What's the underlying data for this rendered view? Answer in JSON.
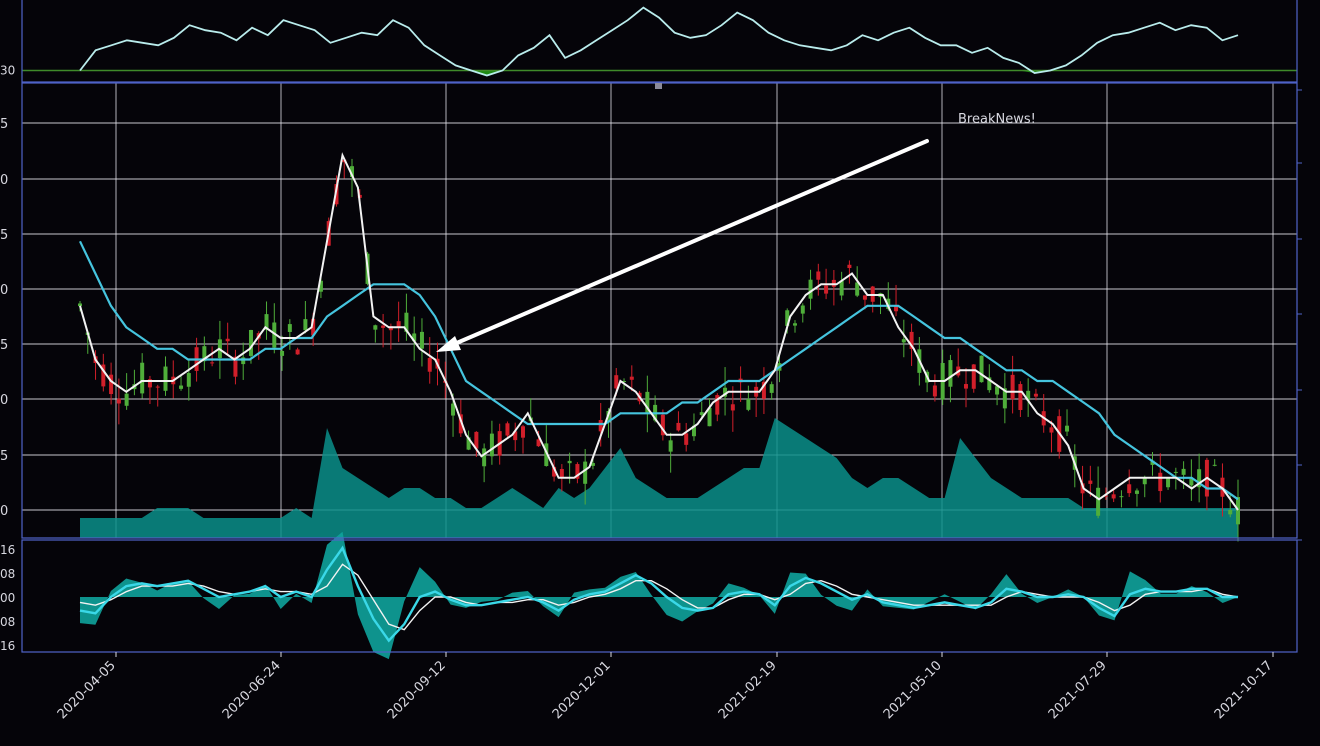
{
  "theme": {
    "background": "#050409",
    "panel_border": "#4f63c8",
    "grid": "#e8e8f0",
    "rsi_line": "#b9ecec",
    "rsi_fill": "#1d8a12",
    "threshold_line": "#3f8a2a",
    "candle_up": "#4fae3a",
    "candle_down": "#d11f2a",
    "sma_fast": "#f2f2f2",
    "sma_slow": "#45c4de",
    "volume_fill": "#0a8f8a",
    "macd_line": "#3ad8e8",
    "signal_line": "#f2f2f2",
    "hist_fill": "#0fa39c",
    "text": "#d8d8e0",
    "arrow": "#ffffff"
  },
  "chart_data": {
    "type": "candlestick",
    "x_ticks": [
      "2020-04-05",
      "2020-06-24",
      "2020-09-12",
      "2020-12-01",
      "2021-02-19",
      "2021-05-10",
      "2021-07-29",
      "2021-10-17"
    ],
    "annotation": {
      "text": "BreakNews!",
      "points_to_date": "2020-09-12"
    },
    "rsi_panel": {
      "threshold_label": "30",
      "threshold": 30,
      "ylim": [
        27,
        60
      ],
      "values": [
        30,
        38,
        40,
        42,
        41,
        40,
        43,
        48,
        46,
        45,
        42,
        47,
        44,
        50,
        48,
        46,
        41,
        43,
        45,
        44,
        50,
        47,
        40,
        36,
        32,
        30,
        28,
        30,
        36,
        39,
        44,
        35,
        38,
        42,
        46,
        50,
        55,
        51,
        45,
        43,
        44,
        48,
        53,
        50,
        45,
        42,
        40,
        39,
        38,
        40,
        44,
        42,
        45,
        47,
        43,
        40,
        40,
        37,
        39,
        35,
        33,
        29,
        30,
        32,
        36,
        41,
        44,
        45,
        47,
        49,
        46,
        48,
        47,
        42,
        44
      ]
    },
    "price_panel": {
      "ytick_labels": [
        "0",
        "5",
        "0",
        "5",
        "0",
        "5",
        "0",
        "5",
        "0",
        "5"
      ],
      "ylim": [
        0,
        41
      ],
      "sma_fast": [
        19,
        14,
        12,
        11,
        12,
        12,
        12,
        13,
        14,
        15,
        14,
        15,
        17,
        16,
        16,
        17,
        25,
        33,
        30,
        18,
        17,
        17,
        15,
        14,
        11,
        7,
        5,
        6,
        7,
        9,
        6,
        3,
        3,
        4,
        8,
        12,
        11,
        9,
        7,
        7,
        8,
        10,
        11,
        11,
        11,
        13,
        18,
        20,
        21,
        21,
        22,
        20,
        20,
        17,
        15,
        12,
        12,
        13,
        13,
        12,
        11,
        11,
        9,
        8,
        6,
        2,
        1,
        2,
        3,
        3,
        3,
        3,
        2,
        3,
        2,
        0
      ],
      "sma_slow": [
        25,
        22,
        19,
        17,
        16,
        15,
        15,
        14,
        14,
        14,
        14,
        14,
        15,
        15,
        16,
        16,
        18,
        19,
        20,
        21,
        21,
        21,
        20,
        18,
        15,
        12,
        11,
        10,
        9,
        8,
        8,
        8,
        8,
        8,
        8,
        9,
        9,
        9,
        9,
        10,
        10,
        11,
        12,
        12,
        12,
        13,
        14,
        15,
        16,
        17,
        18,
        19,
        19,
        19,
        18,
        17,
        16,
        16,
        15,
        14,
        13,
        13,
        12,
        12,
        11,
        10,
        9,
        7,
        6,
        5,
        4,
        3,
        3,
        2,
        2,
        1
      ],
      "volume": [
        1,
        1,
        1,
        1,
        1,
        2,
        2,
        2,
        1,
        1,
        1,
        1,
        1,
        1,
        2,
        1,
        10,
        6,
        5,
        4,
        3,
        4,
        4,
        3,
        3,
        2,
        2,
        3,
        4,
        3,
        2,
        4,
        3,
        4,
        6,
        8,
        5,
        4,
        3,
        3,
        3,
        4,
        5,
        6,
        6,
        11,
        10,
        9,
        8,
        7,
        5,
        4,
        5,
        5,
        4,
        3,
        3,
        9,
        7,
        5,
        4,
        3,
        3,
        3,
        3,
        2,
        2,
        2,
        2,
        2,
        2,
        2,
        2,
        2,
        2,
        2
      ]
    },
    "macd_panel": {
      "ytick_labels": [
        "16",
        "08",
        "00",
        "08",
        "16"
      ],
      "ylim": [
        -0.18,
        0.18
      ],
      "macd": [
        -0.05,
        -0.06,
        0,
        0.04,
        0.05,
        0.04,
        0.05,
        0.06,
        0.03,
        0,
        0.01,
        0.02,
        0.04,
        0,
        0.02,
        0,
        0.1,
        0.18,
        0.04,
        -0.08,
        -0.16,
        -0.1,
        0,
        0.02,
        -0.01,
        -0.03,
        -0.03,
        -0.02,
        -0.01,
        0,
        -0.02,
        -0.05,
        -0.01,
        0.01,
        0.02,
        0.05,
        0.08,
        0.05,
        0,
        -0.04,
        -0.05,
        -0.04,
        0.01,
        0.02,
        0.01,
        -0.03,
        0.04,
        0.07,
        0.05,
        0.02,
        -0.01,
        0.01,
        -0.02,
        -0.03,
        -0.04,
        -0.03,
        -0.02,
        -0.03,
        -0.04,
        -0.02,
        0.03,
        0.02,
        0,
        0,
        0.01,
        0,
        -0.04,
        -0.07,
        0.01,
        0.03,
        0.02,
        0.02,
        0.03,
        0.03,
        0,
        0
      ],
      "signal": [
        -0.02,
        -0.03,
        -0.01,
        0.02,
        0.04,
        0.04,
        0.04,
        0.05,
        0.04,
        0.02,
        0.01,
        0.02,
        0.03,
        0.02,
        0.02,
        0.01,
        0.04,
        0.12,
        0.08,
        -0.01,
        -0.1,
        -0.12,
        -0.05,
        0,
        0,
        -0.02,
        -0.03,
        -0.02,
        -0.02,
        -0.01,
        -0.01,
        -0.03,
        -0.02,
        0,
        0.01,
        0.03,
        0.06,
        0.06,
        0.03,
        -0.01,
        -0.04,
        -0.04,
        -0.01,
        0.01,
        0.01,
        -0.01,
        0.01,
        0.05,
        0.06,
        0.04,
        0.01,
        0,
        -0.01,
        -0.02,
        -0.03,
        -0.03,
        -0.03,
        -0.03,
        -0.03,
        -0.03,
        0,
        0.02,
        0.01,
        0,
        0,
        0,
        -0.02,
        -0.05,
        -0.03,
        0.01,
        0.02,
        0.02,
        0.02,
        0.03,
        0.01,
        0
      ]
    }
  }
}
